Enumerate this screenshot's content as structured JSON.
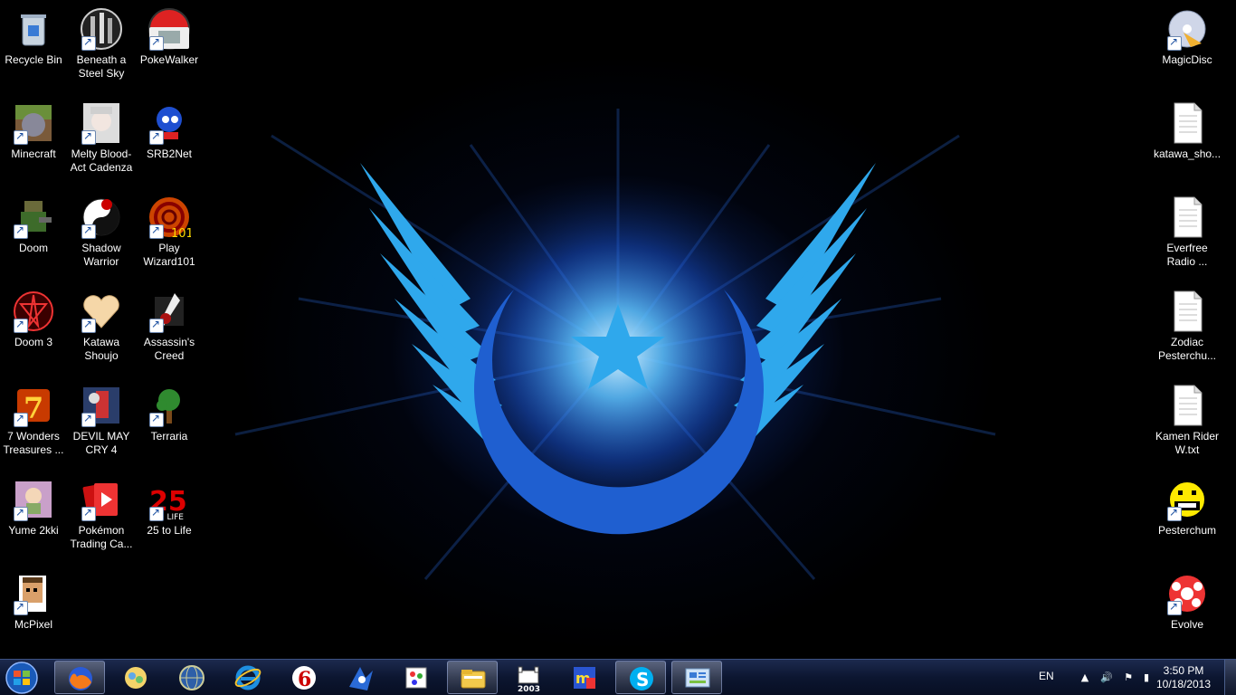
{
  "desktop": {
    "left_icons": [
      {
        "label": "Recycle Bin",
        "icon": "recycle-bin-icon",
        "shortcut": false
      },
      {
        "label": "Beneath a\nSteel Sky",
        "icon": "beneath-a-steel-sky-icon",
        "shortcut": true
      },
      {
        "label": "PokeWalker",
        "icon": "pokewalker-icon",
        "shortcut": true
      },
      {
        "label": "Minecraft",
        "icon": "minecraft-icon",
        "shortcut": true
      },
      {
        "label": "Melty Blood-\nAct Cadenza",
        "icon": "melty-blood-icon",
        "shortcut": true
      },
      {
        "label": "SRB2Net",
        "icon": "srb2net-icon",
        "shortcut": true
      },
      {
        "label": "Doom",
        "icon": "doom-icon",
        "shortcut": true
      },
      {
        "label": "Shadow\nWarrior",
        "icon": "shadow-warrior-icon",
        "shortcut": true
      },
      {
        "label": "Play\nWizard101",
        "icon": "wizard101-icon",
        "shortcut": true
      },
      {
        "label": "Doom 3",
        "icon": "doom3-icon",
        "shortcut": true
      },
      {
        "label": "Katawa\nShoujo",
        "icon": "katawa-shoujo-icon",
        "shortcut": true
      },
      {
        "label": "Assassin's\nCreed",
        "icon": "assassins-creed-icon",
        "shortcut": true
      },
      {
        "label": "7 Wonders\nTreasures ...",
        "icon": "seven-wonders-icon",
        "shortcut": true
      },
      {
        "label": "DEVIL MAY\nCRY 4",
        "icon": "devil-may-cry-icon",
        "shortcut": true
      },
      {
        "label": "Terraria",
        "icon": "terraria-icon",
        "shortcut": true
      },
      {
        "label": "Yume 2kki",
        "icon": "yume-2kki-icon",
        "shortcut": true
      },
      {
        "label": "Pokémon\nTrading Ca...",
        "icon": "pokemon-tcg-icon",
        "shortcut": true
      },
      {
        "label": "25 to Life",
        "icon": "25-to-life-icon",
        "shortcut": true
      },
      {
        "label": "McPixel",
        "icon": "mcpixel-icon",
        "shortcut": true
      }
    ],
    "right_icons": [
      {
        "label": "MagicDisc",
        "icon": "magicdisc-icon",
        "shortcut": true
      },
      {
        "label": "katawa_sho...",
        "icon": "text-file-icon",
        "shortcut": false
      },
      {
        "label": "Everfree\nRadio ...",
        "icon": "text-file-icon",
        "shortcut": false
      },
      {
        "label": "Zodiac\nPesterchu...",
        "icon": "text-file-icon",
        "shortcut": false
      },
      {
        "label": "Kamen Rider\nW.txt",
        "icon": "text-file-icon",
        "shortcut": false
      },
      {
        "label": "Pesterchum",
        "icon": "pesterchum-icon",
        "shortcut": true
      },
      {
        "label": "Evolve",
        "icon": "evolve-icon",
        "shortcut": true
      }
    ]
  },
  "taskbar": {
    "start": "windows-start-icon",
    "buttons": [
      {
        "icon": "firefox-icon",
        "active": true
      },
      {
        "icon": "pinned-app-icon",
        "active": false
      },
      {
        "icon": "globe-icon",
        "active": false
      },
      {
        "icon": "internet-explorer-icon",
        "active": false
      },
      {
        "icon": "touhou-icon",
        "active": false
      },
      {
        "icon": "sonic-icon",
        "active": false
      },
      {
        "icon": "paint-icon",
        "active": false
      },
      {
        "icon": "windows-explorer-icon",
        "active": true
      },
      {
        "icon": "castle-2003-icon",
        "active": false
      },
      {
        "icon": "mp-icon",
        "active": false
      },
      {
        "icon": "skype-icon",
        "active": true
      },
      {
        "icon": "control-panel-icon",
        "active": true
      }
    ],
    "tray": {
      "language": "EN",
      "time": "3:50 PM",
      "date": "10/18/2013"
    }
  },
  "colors": {
    "logo_light": "#2fa8ec",
    "logo_dark": "#1f5fd0",
    "taskbar": "#0c1630"
  }
}
